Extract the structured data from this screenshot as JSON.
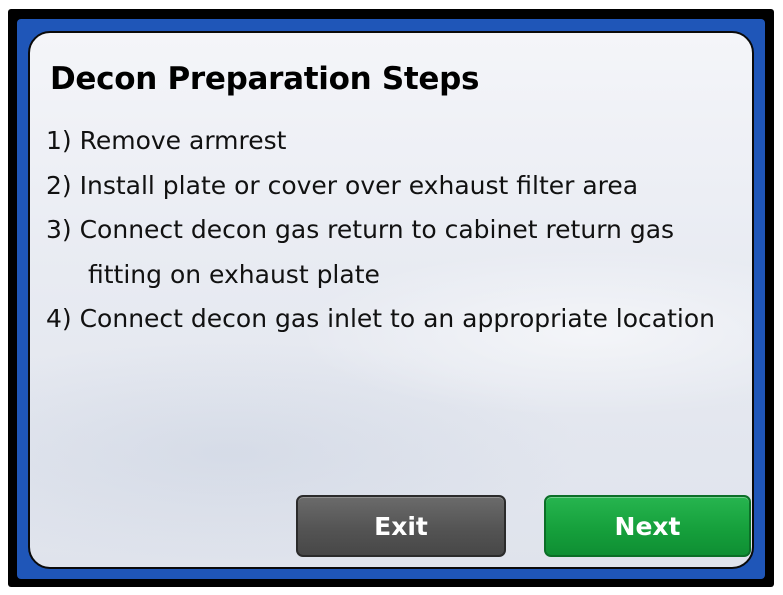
{
  "dialog": {
    "title": "Decon Preparation Steps",
    "steps": [
      "1) Remove armrest",
      "2) Install plate or cover over exhaust filter area",
      "3) Connect decon gas return to cabinet return gas fitting on exhaust plate",
      "4) Connect decon gas inlet to an appropriate location"
    ]
  },
  "buttons": {
    "exit_label": "Exit",
    "next_label": "Next"
  },
  "colors": {
    "border_blue": "#1f56b8",
    "exit_gray": "#545454",
    "next_green": "#16a03c"
  }
}
